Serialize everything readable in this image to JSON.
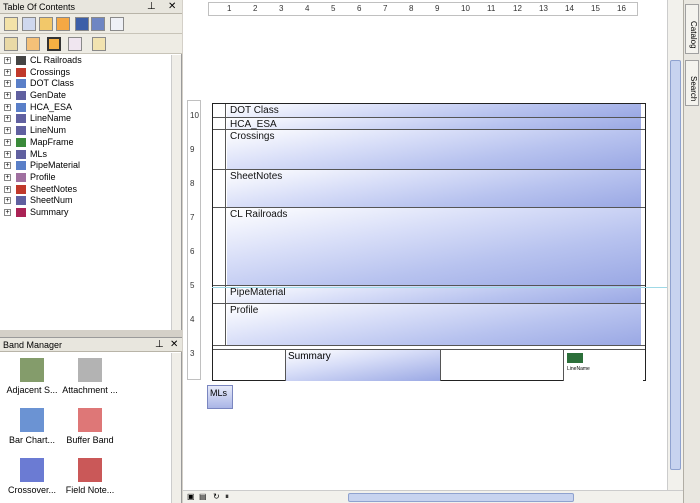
{
  "toc": {
    "title": "Table Of Contents",
    "items": [
      {
        "label": "CL Railroads",
        "icon": "flag-icon"
      },
      {
        "label": "Crossings",
        "icon": "stack-icon"
      },
      {
        "label": "DOT Class",
        "icon": "band-icon"
      },
      {
        "label": "GenDate",
        "icon": "text-icon"
      },
      {
        "label": "HCA_ESA",
        "icon": "band-icon"
      },
      {
        "label": "LineName",
        "icon": "text-icon"
      },
      {
        "label": "LineNum",
        "icon": "text-icon"
      },
      {
        "label": "MapFrame",
        "icon": "globe-icon"
      },
      {
        "label": "MLs",
        "icon": "text-icon"
      },
      {
        "label": "PipeMaterial",
        "icon": "band-icon"
      },
      {
        "label": "Profile",
        "icon": "profile-icon"
      },
      {
        "label": "SheetNotes",
        "icon": "stack-icon"
      },
      {
        "label": "SheetNum",
        "icon": "text-icon"
      },
      {
        "label": "Summary",
        "icon": "sigma-icon"
      }
    ]
  },
  "band_manager": {
    "title": "Band Manager",
    "items": [
      {
        "label": "Adjacent S...",
        "icon": "adjacent-icon"
      },
      {
        "label": "Attachment ...",
        "icon": "paperclip-icon"
      },
      {
        "label": "Bar Chart...",
        "icon": "bar-chart-icon"
      },
      {
        "label": "Buffer Band",
        "icon": "buffer-icon"
      },
      {
        "label": "Crossover...",
        "icon": "crossover-icon"
      },
      {
        "label": "Field Note...",
        "icon": "notebook-icon"
      }
    ]
  },
  "ruler": {
    "h_labels": [
      "1",
      "2",
      "3",
      "4",
      "5",
      "6",
      "7",
      "8",
      "9",
      "10",
      "11",
      "12",
      "13",
      "14",
      "15",
      "16"
    ],
    "v_labels": [
      "10",
      "9",
      "8",
      "7",
      "6",
      "5",
      "4",
      "3"
    ]
  },
  "bands": [
    {
      "label": "DOT Class"
    },
    {
      "label": "HCA_ESA"
    },
    {
      "label": "Crossings"
    },
    {
      "label": "SheetNotes"
    },
    {
      "label": "CL Railroads"
    },
    {
      "label": "PipeMaterial"
    },
    {
      "label": "Profile"
    }
  ],
  "summary": {
    "label": "Summary",
    "linename": "LineName"
  },
  "mls_label": "MLs",
  "side_tabs": [
    "Catalog",
    "Search"
  ]
}
